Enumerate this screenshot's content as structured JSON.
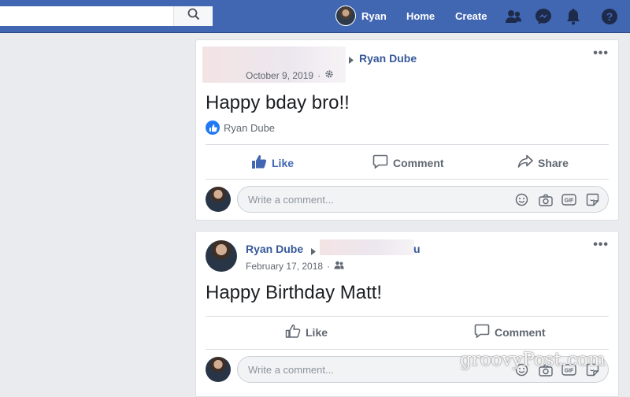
{
  "nav": {
    "profile_name": "Ryan",
    "home_label": "Home",
    "create_label": "Create"
  },
  "posts": [
    {
      "author_link": "Ryan Dube",
      "date": "October 9, 2019",
      "text": "Happy bday bro!!",
      "reaction_name": "Ryan Dube",
      "like_label": "Like",
      "comment_label": "Comment",
      "share_label": "Share",
      "comment_placeholder": "Write a comment..."
    },
    {
      "author": "Ryan Dube",
      "recipient_suffix": "u",
      "date": "February 17, 2018",
      "text": "Happy Birthday Matt!",
      "like_label": "Like",
      "comment_label": "Comment",
      "comment_placeholder": "Write a comment..."
    }
  ],
  "watermark": "groovyPost.com",
  "icons": {
    "search": "search-icon",
    "friends": "friends-icon",
    "messenger": "messenger-icon",
    "notifications": "bell-icon",
    "help": "help-icon",
    "more": "more-options-icon",
    "audience_public": "gear-icon",
    "audience_friends": "friends-icon",
    "emoji": "emoji-icon",
    "camera": "camera-icon",
    "gif": "gif-icon",
    "sticker": "sticker-icon"
  },
  "colors": {
    "topbar": "#4267b2",
    "link": "#365899",
    "like_active": "#4267b2",
    "page_bg": "#e9ebee"
  }
}
